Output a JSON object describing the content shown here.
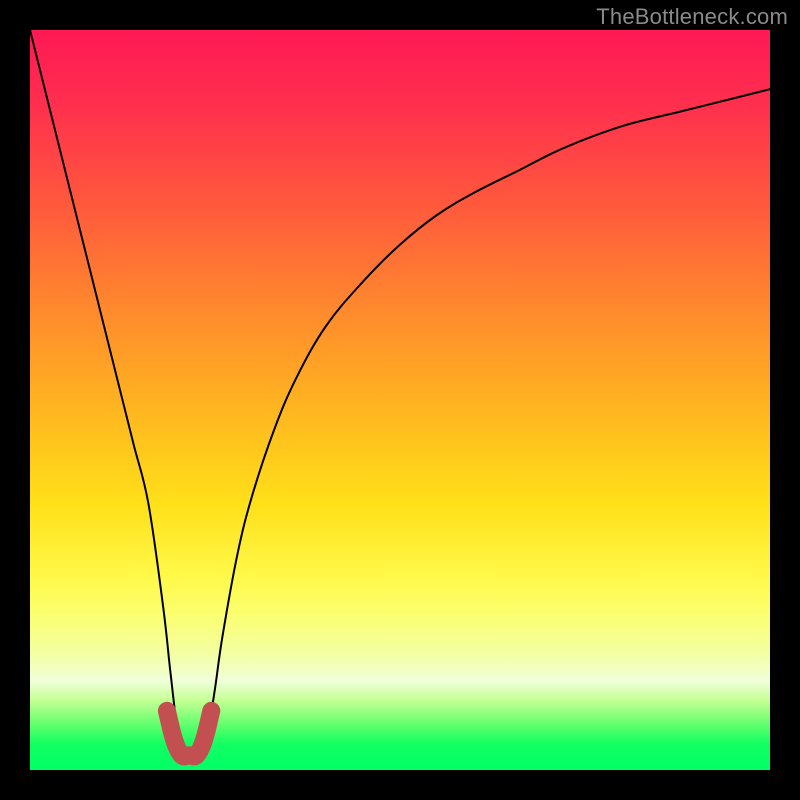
{
  "attribution": "TheBottleneck.com",
  "chart_data": {
    "type": "line",
    "title": "",
    "xlabel": "",
    "ylabel": "",
    "xlim": [
      0,
      100
    ],
    "ylim": [
      0,
      100
    ],
    "series": [
      {
        "name": "bottleneck-curve",
        "x": [
          0,
          2,
          4,
          6,
          8,
          10,
          12,
          14,
          16,
          18,
          19,
          20,
          21,
          22,
          23,
          24,
          25,
          26,
          28,
          30,
          33,
          36,
          40,
          45,
          50,
          55,
          60,
          66,
          72,
          80,
          88,
          96,
          100
        ],
        "y": [
          100,
          92,
          84,
          76,
          68,
          60,
          52,
          44,
          36,
          22,
          13,
          5,
          2,
          2,
          2,
          5,
          11,
          18,
          29,
          37,
          46,
          53,
          60,
          66,
          71,
          75,
          78,
          81,
          84,
          87,
          89,
          91,
          92
        ]
      }
    ],
    "annotations": [
      {
        "name": "trough-highlight",
        "x": [
          18.5,
          19.5,
          20.5,
          21.5,
          22.5,
          23.5,
          24.5
        ],
        "y": [
          8,
          4,
          2,
          2,
          2,
          4,
          8
        ],
        "color": "#c25050"
      }
    ],
    "background_gradient": {
      "top": "#ff1955",
      "middle": "#ffe019",
      "bottom": "#00ff66"
    }
  }
}
